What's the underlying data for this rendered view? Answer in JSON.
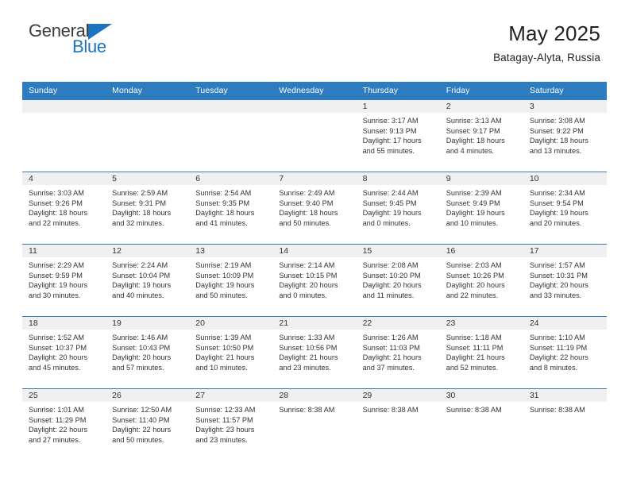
{
  "logo": {
    "word1": "General",
    "word2": "Blue",
    "triangle_icon": "triangle-icon",
    "color_dark": "#3b3b3b",
    "color_blue": "#1b74bd"
  },
  "header": {
    "title": "May 2025",
    "subtitle": "Batagay-Alyta, Russia"
  },
  "theme": {
    "header_bg": "#2d7cc0",
    "header_text": "#ffffff",
    "daynum_bg": "#f0f0f0",
    "cell_text": "#333333",
    "grid_line": "#2d7cc0"
  },
  "calendar": {
    "weekday_headers": [
      "Sunday",
      "Monday",
      "Tuesday",
      "Wednesday",
      "Thursday",
      "Friday",
      "Saturday"
    ],
    "weeks": [
      [
        {
          "day": "",
          "lines": []
        },
        {
          "day": "",
          "lines": []
        },
        {
          "day": "",
          "lines": []
        },
        {
          "day": "",
          "lines": []
        },
        {
          "day": "1",
          "lines": [
            "Sunrise: 3:17 AM",
            "Sunset: 9:13 PM",
            "Daylight: 17 hours",
            "and 55 minutes."
          ]
        },
        {
          "day": "2",
          "lines": [
            "Sunrise: 3:13 AM",
            "Sunset: 9:17 PM",
            "Daylight: 18 hours",
            "and 4 minutes."
          ]
        },
        {
          "day": "3",
          "lines": [
            "Sunrise: 3:08 AM",
            "Sunset: 9:22 PM",
            "Daylight: 18 hours",
            "and 13 minutes."
          ]
        }
      ],
      [
        {
          "day": "4",
          "lines": [
            "Sunrise: 3:03 AM",
            "Sunset: 9:26 PM",
            "Daylight: 18 hours",
            "and 22 minutes."
          ]
        },
        {
          "day": "5",
          "lines": [
            "Sunrise: 2:59 AM",
            "Sunset: 9:31 PM",
            "Daylight: 18 hours",
            "and 32 minutes."
          ]
        },
        {
          "day": "6",
          "lines": [
            "Sunrise: 2:54 AM",
            "Sunset: 9:35 PM",
            "Daylight: 18 hours",
            "and 41 minutes."
          ]
        },
        {
          "day": "7",
          "lines": [
            "Sunrise: 2:49 AM",
            "Sunset: 9:40 PM",
            "Daylight: 18 hours",
            "and 50 minutes."
          ]
        },
        {
          "day": "8",
          "lines": [
            "Sunrise: 2:44 AM",
            "Sunset: 9:45 PM",
            "Daylight: 19 hours",
            "and 0 minutes."
          ]
        },
        {
          "day": "9",
          "lines": [
            "Sunrise: 2:39 AM",
            "Sunset: 9:49 PM",
            "Daylight: 19 hours",
            "and 10 minutes."
          ]
        },
        {
          "day": "10",
          "lines": [
            "Sunrise: 2:34 AM",
            "Sunset: 9:54 PM",
            "Daylight: 19 hours",
            "and 20 minutes."
          ]
        }
      ],
      [
        {
          "day": "11",
          "lines": [
            "Sunrise: 2:29 AM",
            "Sunset: 9:59 PM",
            "Daylight: 19 hours",
            "and 30 minutes."
          ]
        },
        {
          "day": "12",
          "lines": [
            "Sunrise: 2:24 AM",
            "Sunset: 10:04 PM",
            "Daylight: 19 hours",
            "and 40 minutes."
          ]
        },
        {
          "day": "13",
          "lines": [
            "Sunrise: 2:19 AM",
            "Sunset: 10:09 PM",
            "Daylight: 19 hours",
            "and 50 minutes."
          ]
        },
        {
          "day": "14",
          "lines": [
            "Sunrise: 2:14 AM",
            "Sunset: 10:15 PM",
            "Daylight: 20 hours",
            "and 0 minutes."
          ]
        },
        {
          "day": "15",
          "lines": [
            "Sunrise: 2:08 AM",
            "Sunset: 10:20 PM",
            "Daylight: 20 hours",
            "and 11 minutes."
          ]
        },
        {
          "day": "16",
          "lines": [
            "Sunrise: 2:03 AM",
            "Sunset: 10:26 PM",
            "Daylight: 20 hours",
            "and 22 minutes."
          ]
        },
        {
          "day": "17",
          "lines": [
            "Sunrise: 1:57 AM",
            "Sunset: 10:31 PM",
            "Daylight: 20 hours",
            "and 33 minutes."
          ]
        }
      ],
      [
        {
          "day": "18",
          "lines": [
            "Sunrise: 1:52 AM",
            "Sunset: 10:37 PM",
            "Daylight: 20 hours",
            "and 45 minutes."
          ]
        },
        {
          "day": "19",
          "lines": [
            "Sunrise: 1:46 AM",
            "Sunset: 10:43 PM",
            "Daylight: 20 hours",
            "and 57 minutes."
          ]
        },
        {
          "day": "20",
          "lines": [
            "Sunrise: 1:39 AM",
            "Sunset: 10:50 PM",
            "Daylight: 21 hours",
            "and 10 minutes."
          ]
        },
        {
          "day": "21",
          "lines": [
            "Sunrise: 1:33 AM",
            "Sunset: 10:56 PM",
            "Daylight: 21 hours",
            "and 23 minutes."
          ]
        },
        {
          "day": "22",
          "lines": [
            "Sunrise: 1:26 AM",
            "Sunset: 11:03 PM",
            "Daylight: 21 hours",
            "and 37 minutes."
          ]
        },
        {
          "day": "23",
          "lines": [
            "Sunrise: 1:18 AM",
            "Sunset: 11:11 PM",
            "Daylight: 21 hours",
            "and 52 minutes."
          ]
        },
        {
          "day": "24",
          "lines": [
            "Sunrise: 1:10 AM",
            "Sunset: 11:19 PM",
            "Daylight: 22 hours",
            "and 8 minutes."
          ]
        }
      ],
      [
        {
          "day": "25",
          "lines": [
            "Sunrise: 1:01 AM",
            "Sunset: 11:29 PM",
            "Daylight: 22 hours",
            "and 27 minutes."
          ]
        },
        {
          "day": "26",
          "lines": [
            "Sunrise: 12:50 AM",
            "Sunset: 11:40 PM",
            "Daylight: 22 hours",
            "and 50 minutes."
          ]
        },
        {
          "day": "27",
          "lines": [
            "Sunrise: 12:33 AM",
            "Sunset: 11:57 PM",
            "Daylight: 23 hours",
            "and 23 minutes."
          ]
        },
        {
          "day": "28",
          "lines": [
            "Sunrise: 8:38 AM"
          ]
        },
        {
          "day": "29",
          "lines": [
            "Sunrise: 8:38 AM"
          ]
        },
        {
          "day": "30",
          "lines": [
            "Sunrise: 8:38 AM"
          ]
        },
        {
          "day": "31",
          "lines": [
            "Sunrise: 8:38 AM"
          ]
        }
      ]
    ]
  }
}
